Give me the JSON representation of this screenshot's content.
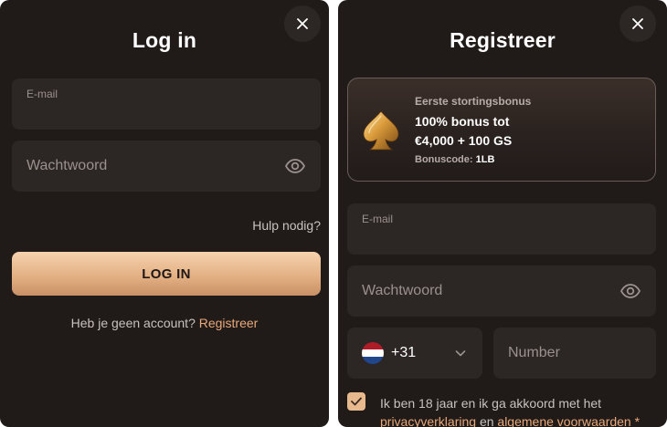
{
  "login": {
    "title": "Log in",
    "email_label": "E-mail",
    "password_placeholder": "Wachtwoord",
    "help_link": "Hulp nodig?",
    "submit_label": "LOG IN",
    "no_account_text": "Heb je geen account?",
    "register_link": "Registreer"
  },
  "register": {
    "title": "Registreer",
    "bonus": {
      "kicker": "Eerste stortingsbonus",
      "line1": "100% bonus tot",
      "line2": "€4,000 + 100 GS",
      "code_label": "Bonuscode:",
      "code_value": "1LB"
    },
    "email_label": "E-mail",
    "password_placeholder": "Wachtwoord",
    "phone": {
      "dial_code": "+31",
      "number_placeholder": "Number"
    },
    "terms": {
      "prefix": "Ik ben 18 jaar en ik ga akkoord met het",
      "privacy_link": "privacyverklaring",
      "and": "en",
      "terms_link": "algemene voorwaarden",
      "required_mark": "*"
    }
  },
  "icons": {
    "close": "close-icon",
    "eye": "eye-icon",
    "spade": "spade-icon",
    "flag": "netherlands-flag-icon",
    "chevron": "chevron-down-icon",
    "check": "check-icon"
  },
  "colors": {
    "panel_bg": "#201b19",
    "field_bg": "#2c2624",
    "accent": "#e9a87a",
    "button_gradient_top": "#f6d2af",
    "button_gradient_bottom": "#c99066"
  }
}
